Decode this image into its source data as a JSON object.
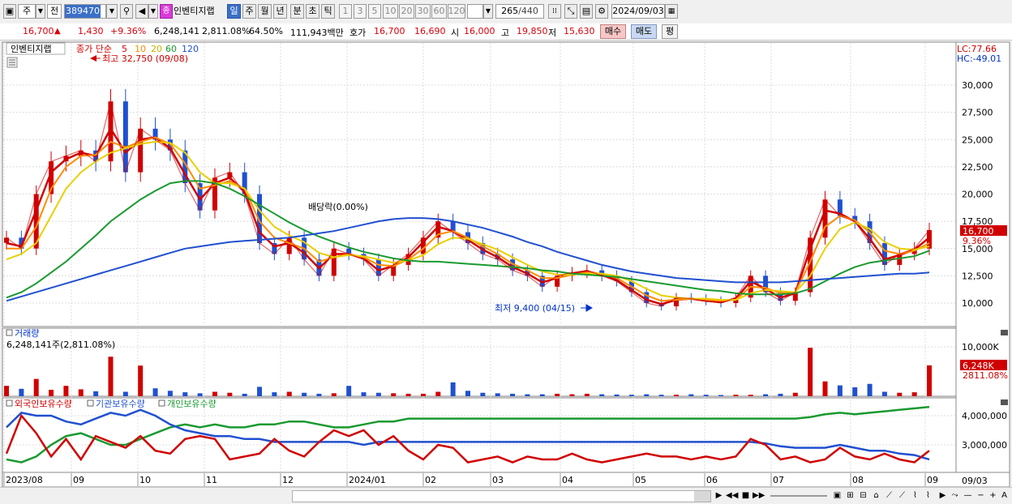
{
  "toolbar": {
    "market": "주",
    "prefix": "전",
    "code": "389470",
    "stock_name": "인벤티지랩",
    "stock_badge": "종",
    "periods": [
      "일",
      "주",
      "월",
      "년",
      "분",
      "초",
      "틱"
    ],
    "numbers": [
      "1",
      "3",
      "5",
      "10",
      "20",
      "30",
      "60",
      "120"
    ],
    "count": "265",
    "count_total": "/440",
    "date": "2024/09/03"
  },
  "info": {
    "price": "16,700",
    "arrow": "▲",
    "change": "1,430",
    "change_pct": "+9.36%",
    "volume": "6,248,141",
    "volume_pct": "2,811.08%",
    "turnover": "64.50%",
    "amount": "111,943백만",
    "bid_label": "호가",
    "bid1": "16,700",
    "bid2": "16,690",
    "open_label": "시",
    "open": "16,000",
    "high_label": "고",
    "high": "19,850",
    "low_label": "저",
    "low": "15,630",
    "buy": "매수",
    "sell": "매도",
    "eval": "평"
  },
  "price_panel": {
    "title": "인벤티지랩",
    "legend_prefix": "종가 단순",
    "ma_periods": [
      "5",
      "10",
      "20",
      "60",
      "120"
    ],
    "ma_colors": [
      "#d00000",
      "#ff8c00",
      "#e8d000",
      "#1a9a30",
      "#2050d0"
    ],
    "high_note": "최고 32,750 (09/08)",
    "low_note": "최저 9,400 (04/15)",
    "dividend_note": "배당락(0.00%)",
    "lc": "LC:77.66",
    "hc": "HC:-49.01",
    "y_ticks": [
      "30,000",
      "27,500",
      "25,000",
      "22,500",
      "20,000",
      "17,500",
      "15,000",
      "12,500",
      "10,000"
    ],
    "price_tag": "16,700",
    "pct_tag": "9.36%"
  },
  "volume_panel": {
    "title": "거래량",
    "value_line": "6,248,141주(2,811.08%)",
    "y_tick": "10,000K",
    "vol_tag": "6,248K",
    "pct_tag": "2811.08%"
  },
  "holding_panel": {
    "legend": [
      {
        "label": "외국인보유수량",
        "color": "#d00000"
      },
      {
        "label": "기관보유수량",
        "color": "#2050d0"
      },
      {
        "label": "개인보유수량",
        "color": "#1a9a30"
      }
    ],
    "y_ticks": [
      "4,000,000",
      "3,000,000"
    ]
  },
  "x_axis": {
    "labels": [
      "2023/08",
      "09",
      "10",
      "11",
      "12",
      "2024/01",
      "02",
      "03",
      "04",
      "05",
      "06",
      "07",
      "08",
      "09"
    ],
    "right_date": "09/03"
  },
  "chart_data": [
    {
      "type": "line",
      "title": "인벤티지랩",
      "y_range": [
        8500,
        33000
      ],
      "price_end": 16700,
      "series": [
        {
          "name": "종가",
          "values": [
            16000,
            15000,
            20000,
            23000,
            23500,
            24000,
            23000,
            28500,
            22000,
            26000,
            25000,
            24000,
            21000,
            18500,
            21500,
            22000,
            20000,
            15500,
            14500,
            16000,
            14000,
            12500,
            15000,
            14500,
            14000,
            12500,
            13500,
            14500,
            16000,
            17500,
            16500,
            15500,
            14500,
            14000,
            13000,
            12500,
            11500,
            12500,
            12800,
            13000,
            12500,
            12000,
            11000,
            10000,
            9700,
            10500,
            10400,
            10200,
            10000,
            10500,
            12500,
            11000,
            10200,
            11000,
            16000,
            19500,
            18000,
            17500,
            15500,
            13500,
            14500,
            15000,
            16700
          ]
        },
        {
          "name": "5",
          "values": [
            15500,
            15200,
            18500,
            22000,
            23200,
            23800,
            23500,
            26000,
            23800,
            25000,
            25200,
            24200,
            21800,
            19500,
            21000,
            21500,
            20200,
            16500,
            15200,
            15500,
            14600,
            13200,
            14500,
            14500,
            14100,
            13000,
            13400,
            14200,
            15600,
            17000,
            16600,
            15800,
            14900,
            14200,
            13300,
            12700,
            11900,
            12300,
            12700,
            12900,
            12600,
            12100,
            11200,
            10300,
            9900,
            10300,
            10400,
            10200,
            10100,
            10400,
            12000,
            11300,
            10500,
            10900,
            15000,
            18500,
            18200,
            17500,
            15900,
            14000,
            14400,
            14900,
            16000
          ]
        },
        {
          "name": "10",
          "values": [
            15000,
            15000,
            17000,
            20500,
            22500,
            23500,
            23600,
            24800,
            24300,
            24800,
            25200,
            24600,
            22800,
            20500,
            20800,
            21200,
            20500,
            17500,
            16000,
            15500,
            15000,
            13800,
            14200,
            14500,
            14200,
            13500,
            13400,
            14000,
            15000,
            16300,
            16600,
            16000,
            15200,
            14500,
            13600,
            13000,
            12300,
            12300,
            12600,
            12800,
            12700,
            12300,
            11500,
            10700,
            10200,
            10300,
            10400,
            10300,
            10200,
            10300,
            11500,
            11400,
            10900,
            11000,
            13800,
            17000,
            18000,
            17600,
            16500,
            14800,
            14500,
            14800,
            15500
          ]
        },
        {
          "name": "20",
          "values": [
            14000,
            14500,
            15500,
            18000,
            20500,
            22000,
            23000,
            23800,
            24200,
            24600,
            24800,
            24700,
            23800,
            22000,
            21000,
            21000,
            20500,
            18500,
            17000,
            16200,
            15600,
            14600,
            14200,
            14400,
            14300,
            14000,
            13700,
            13900,
            14400,
            15400,
            16000,
            15900,
            15400,
            14900,
            14200,
            13500,
            12900,
            12600,
            12600,
            12700,
            12700,
            12500,
            12000,
            11300,
            10700,
            10500,
            10400,
            10400,
            10300,
            10300,
            10900,
            11200,
            11100,
            11000,
            12500,
            15000,
            16800,
            17400,
            16800,
            15600,
            15000,
            14900,
            15200
          ]
        },
        {
          "name": "60",
          "values": [
            10500,
            11000,
            11800,
            12800,
            13800,
            15000,
            16200,
            17500,
            18500,
            19500,
            20300,
            21000,
            21200,
            21200,
            21000,
            20500,
            19800,
            19000,
            18200,
            17400,
            16700,
            16100,
            15600,
            15100,
            14700,
            14400,
            14100,
            13900,
            13800,
            13800,
            13700,
            13600,
            13500,
            13400,
            13300,
            13200,
            13000,
            12900,
            12700,
            12600,
            12500,
            12400,
            12200,
            12000,
            11800,
            11600,
            11400,
            11200,
            11100,
            10900,
            10800,
            10800,
            10800,
            10900,
            11300,
            12000,
            12700,
            13300,
            13700,
            13900,
            14100,
            14300,
            14800
          ]
        },
        {
          "name": "120",
          "values": [
            10200,
            10600,
            11000,
            11400,
            11800,
            12200,
            12600,
            13000,
            13400,
            13800,
            14200,
            14600,
            15000,
            15200,
            15400,
            15600,
            15700,
            15800,
            15900,
            16000,
            16200,
            16400,
            16600,
            16900,
            17200,
            17500,
            17700,
            17800,
            17800,
            17700,
            17500,
            17200,
            16900,
            16500,
            16100,
            15600,
            15200,
            14700,
            14300,
            13900,
            13500,
            13200,
            12900,
            12700,
            12500,
            12300,
            12200,
            12100,
            12000,
            11900,
            11900,
            11900,
            11900,
            12000,
            12100,
            12200,
            12300,
            12400,
            12500,
            12600,
            12700,
            12700,
            12800
          ]
        }
      ]
    },
    {
      "type": "bar",
      "title": "거래량",
      "y_range": [
        0,
        11000
      ],
      "unit": "K",
      "values": [
        2100,
        1500,
        3500,
        1300,
        2100,
        1400,
        1000,
        8000,
        900,
        6200,
        1600,
        1100,
        800,
        600,
        900,
        700,
        500,
        1900,
        800,
        900,
        700,
        500,
        600,
        2100,
        800,
        700,
        600,
        500,
        500,
        900,
        2800,
        1100,
        700,
        600,
        500,
        400,
        400,
        500,
        400,
        500,
        400,
        350,
        300,
        400,
        300,
        300,
        400,
        300,
        250,
        300,
        300,
        400,
        500,
        700,
        9800,
        3000,
        2200,
        1800,
        2500,
        900,
        700,
        800,
        6248
      ]
    },
    {
      "type": "line",
      "title": "외국인보유수량",
      "y_range": [
        2200000,
        4500000
      ],
      "series": [
        {
          "name": "외국인보유수량",
          "values": [
            2700000,
            4000000,
            3400000,
            2600000,
            3200000,
            2500000,
            3300000,
            3100000,
            2900000,
            3300000,
            2800000,
            2700000,
            3200000,
            3300000,
            3200000,
            2500000,
            2600000,
            2700000,
            3200000,
            2800000,
            2600000,
            3100000,
            3500000,
            3300000,
            3500000,
            3000000,
            3300000,
            2800000,
            2500000,
            3000000,
            2900000,
            2400000,
            2500000,
            2600000,
            2400000,
            2600000,
            2500000,
            2500000,
            2700000,
            2500000,
            2400000,
            2500000,
            2600000,
            2700000,
            2600000,
            2600000,
            2500000,
            2600000,
            2500000,
            2600000,
            3200000,
            3000000,
            2500000,
            2600000,
            2400000,
            2500000,
            2900000,
            2600000,
            2500000,
            2700000,
            2500000,
            2400000,
            2800000
          ]
        },
        {
          "name": "기관보유수량",
          "values": [
            3600000,
            4100000,
            4000000,
            4000000,
            3800000,
            3700000,
            3900000,
            4100000,
            4000000,
            4200000,
            4000000,
            3700000,
            3500000,
            3400000,
            3300000,
            3300000,
            3200000,
            3200000,
            3100000,
            3100000,
            3100000,
            3100000,
            3100000,
            3100000,
            3000000,
            3100000,
            3100000,
            3100000,
            3100000,
            3100000,
            3100000,
            3100000,
            3100000,
            3100000,
            3100000,
            3100000,
            3100000,
            3100000,
            3100000,
            3100000,
            3100000,
            3100000,
            3100000,
            3100000,
            3100000,
            3100000,
            3100000,
            3100000,
            3100000,
            3100000,
            3100000,
            3050000,
            2950000,
            2900000,
            2900000,
            2900000,
            3000000,
            2900000,
            2800000,
            2800000,
            2700000,
            2650000,
            2500000
          ]
        },
        {
          "name": "개인보유수량",
          "values": [
            2500000,
            2400000,
            2600000,
            3000000,
            3300000,
            3400000,
            3200000,
            3000000,
            3000000,
            3200000,
            3400000,
            3600000,
            3700000,
            3600000,
            3700000,
            3600000,
            3600000,
            3700000,
            3700000,
            3800000,
            3800000,
            3700000,
            3600000,
            3600000,
            3700000,
            3800000,
            3800000,
            3900000,
            3900000,
            3900000,
            3900000,
            3900000,
            3900000,
            3900000,
            3900000,
            3900000,
            3900000,
            3900000,
            3900000,
            3900000,
            3900000,
            3900000,
            3900000,
            3900000,
            3900000,
            3900000,
            3900000,
            3900000,
            3900000,
            3900000,
            3900000,
            3900000,
            3900000,
            3900000,
            3950000,
            4050000,
            4100000,
            4050000,
            4100000,
            4150000,
            4200000,
            4250000,
            4300000
          ]
        }
      ]
    }
  ]
}
